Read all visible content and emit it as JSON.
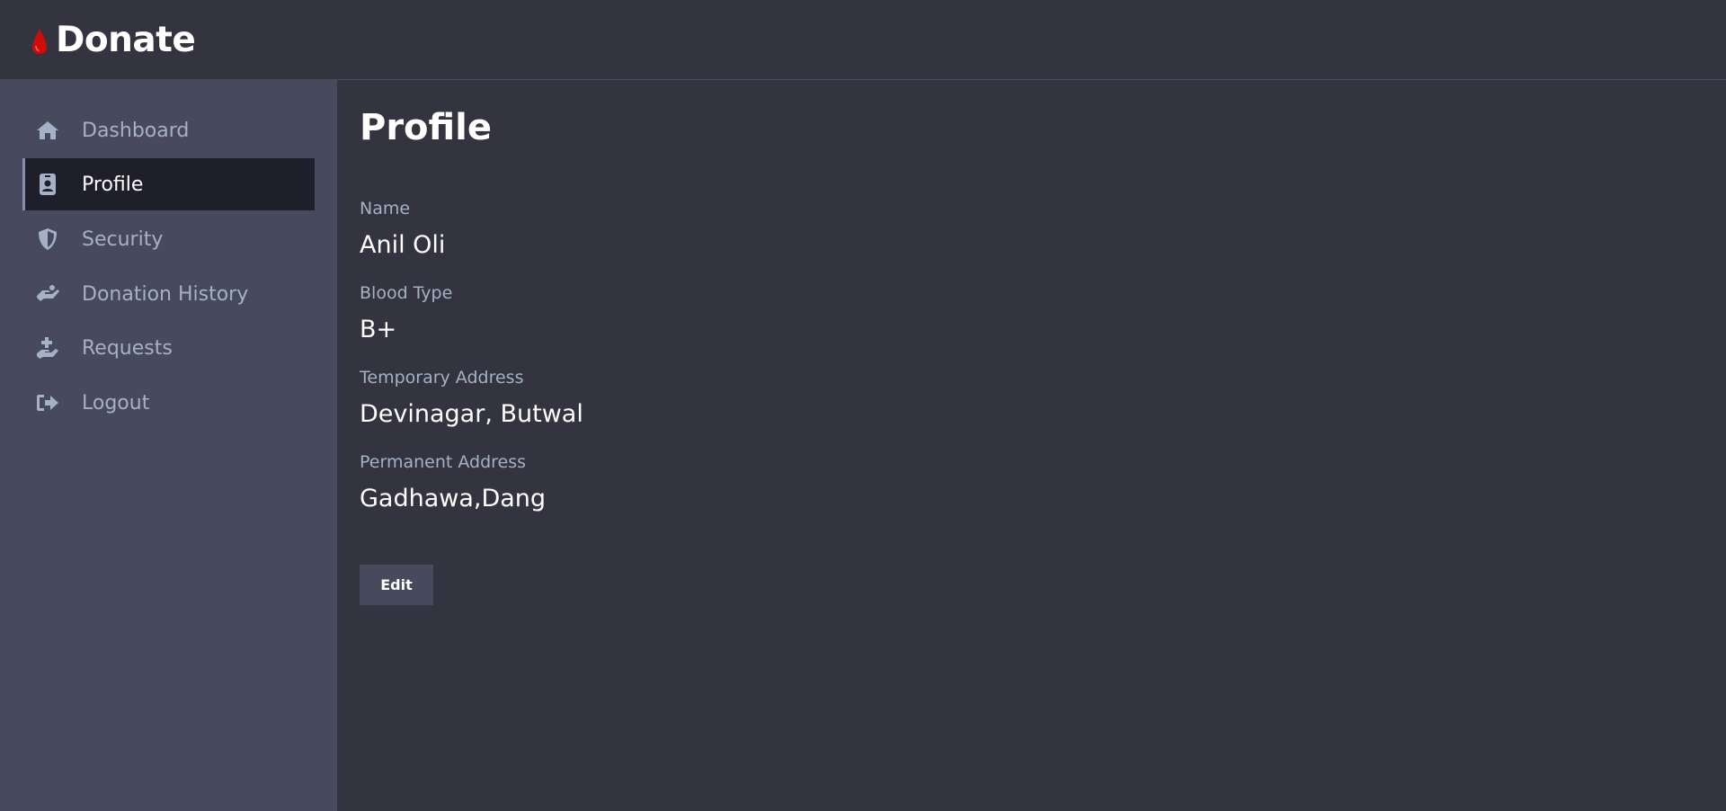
{
  "brand": {
    "title": "Donate",
    "logo_icon": "blood-drop-icon",
    "logo_color": "#d10a0a"
  },
  "sidebar": {
    "items": [
      {
        "label": "Dashboard",
        "icon": "home-icon"
      },
      {
        "label": "Profile",
        "icon": "id-badge-icon",
        "active": true
      },
      {
        "label": "Security",
        "icon": "shield-icon"
      },
      {
        "label": "Donation History",
        "icon": "hand-holding-icon"
      },
      {
        "label": "Requests",
        "icon": "hand-medical-icon"
      },
      {
        "label": "Logout",
        "icon": "sign-out-icon"
      }
    ]
  },
  "main": {
    "title": "Profile",
    "fields": [
      {
        "label": "Name",
        "value": "Anil Oli"
      },
      {
        "label": "Blood Type",
        "value": "B+"
      },
      {
        "label": "Temporary Address",
        "value": "Devinagar, Butwal"
      },
      {
        "label": "Permanent Address",
        "value": "Gadhawa,Dang"
      }
    ],
    "edit_label": "Edit"
  },
  "colors": {
    "background": "#33343f",
    "sidebar": "#474a5d",
    "active_item": "#1f1f2b",
    "muted_text": "#a4b1c6"
  }
}
